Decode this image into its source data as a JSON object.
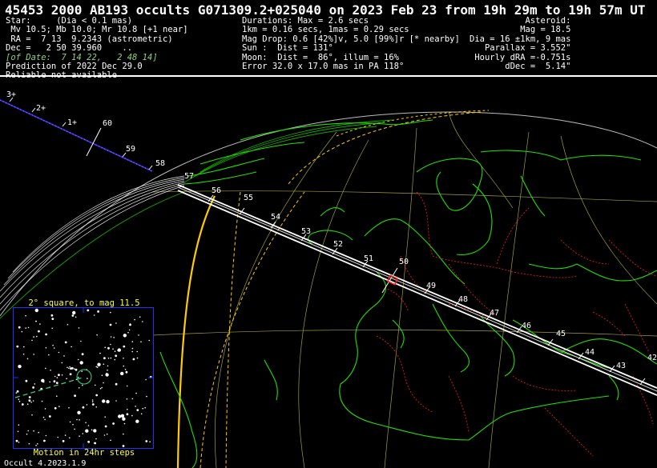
{
  "title": "45453 2000 AB193 occults G071309.2+025040 on 2023 Feb 23 from 19h 29m to 19h 57m UT",
  "star": {
    "header": "Star:     (Dia < 0.1 mas)",
    "mags": " Mv 10.5; Mb 10.0; Mr 10.8 [+1 near]",
    "ra": " RA =  7 13  9.2343 (astrometric)",
    "dec": "Dec =   2 50 39.960    ..",
    "of_date": "[of Date:  7 14 22,   2 48 14]",
    "prediction": "Prediction of 2022 Dec 29.0",
    "reliable": "Reliable not available"
  },
  "event": {
    "durations": "Durations: Max = 2.6 secs",
    "scale": "1km = 0.16 secs, 1mas = 0.29 secs",
    "mag_drop": "Mag Drop: 0.6 [42%]v, 5.0 [99%]r [* nearby]",
    "sun": "Sun :  Dist = 131°",
    "moon": "Moon:  Dist =  86°, illum = 16%",
    "error": "Error 32.0 x 17.0 mas in PA 118°"
  },
  "asteroid": {
    "header": "Asteroid:",
    "mag": "Mag = 18.5",
    "dia": "Dia = 16 ±1km, 9 mas",
    "parallax": "Parallax = 3.552\"",
    "hourly_dra": "Hourly dRA =-0.751s",
    "ddec": "dDec =  5.14\""
  },
  "map": {
    "path_time_labels": [
      "57",
      "56",
      "55",
      "54",
      "53",
      "52",
      "51",
      "50",
      "49",
      "48",
      "47",
      "46",
      "45",
      "44",
      "43",
      "42"
    ],
    "upper_scale_labels": [
      "3+",
      "2+",
      "1+"
    ],
    "upper_time_labels": [
      "60",
      "59",
      "58"
    ],
    "colors": {
      "path": "#ffffff",
      "coast": "#22e000",
      "borders": "#cc1a1a",
      "grid": "#c8c850",
      "sun_limit": "#ffcc00",
      "sigma_line": "#2b3fff",
      "site": "#ff2020"
    }
  },
  "starchart": {
    "title": "2° square, to mag 11.5",
    "caption": "Motion in 24hr steps"
  },
  "version": "Occult 4.2023.1.9"
}
